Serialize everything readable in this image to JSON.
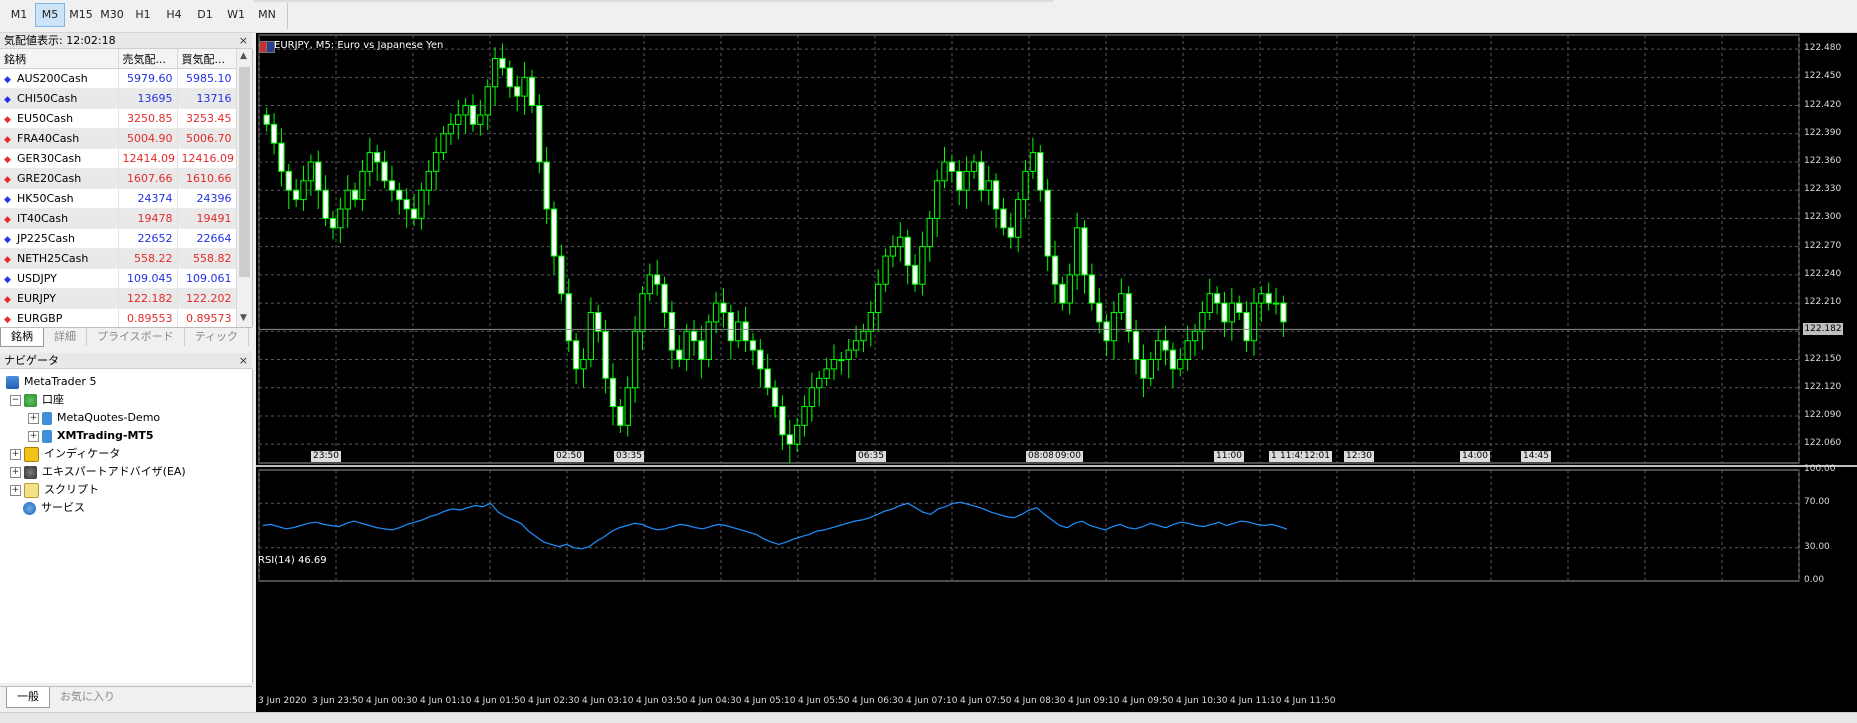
{
  "toolbar": {
    "timeframes": [
      "M1",
      "M5",
      "M15",
      "M30",
      "H1",
      "H4",
      "D1",
      "W1",
      "MN"
    ],
    "active": "M5"
  },
  "market_watch": {
    "title": "気配値表示: 12:02:18",
    "columns": [
      "銘柄",
      "売気配...",
      "買気配..."
    ],
    "rows": [
      {
        "symbol": "AUS200Cash",
        "bid": "5979.60",
        "ask": "5985.10",
        "dir": "up"
      },
      {
        "symbol": "CHI50Cash",
        "bid": "13695",
        "ask": "13716",
        "dir": "up"
      },
      {
        "symbol": "EU50Cash",
        "bid": "3250.85",
        "ask": "3253.45",
        "dir": "down"
      },
      {
        "symbol": "FRA40Cash",
        "bid": "5004.90",
        "ask": "5006.70",
        "dir": "down"
      },
      {
        "symbol": "GER30Cash",
        "bid": "12414.09",
        "ask": "12416.09",
        "dir": "down"
      },
      {
        "symbol": "GRE20Cash",
        "bid": "1607.66",
        "ask": "1610.66",
        "dir": "down"
      },
      {
        "symbol": "HK50Cash",
        "bid": "24374",
        "ask": "24396",
        "dir": "up"
      },
      {
        "symbol": "IT40Cash",
        "bid": "19478",
        "ask": "19491",
        "dir": "down"
      },
      {
        "symbol": "JP225Cash",
        "bid": "22652",
        "ask": "22664",
        "dir": "up"
      },
      {
        "symbol": "NETH25Cash",
        "bid": "558.22",
        "ask": "558.82",
        "dir": "down"
      },
      {
        "symbol": "USDJPY",
        "bid": "109.045",
        "ask": "109.061",
        "dir": "up"
      },
      {
        "symbol": "EURJPY",
        "bid": "122.182",
        "ask": "122.202",
        "dir": "down"
      },
      {
        "symbol": "EURGBP",
        "bid": "0.89553",
        "ask": "0.89573",
        "dir": "down"
      }
    ],
    "tabs": [
      "銘柄",
      "詳細",
      "プライスボード",
      "ティック"
    ],
    "close_icon": "×"
  },
  "navigator": {
    "title": "ナビゲータ",
    "root": "MetaTrader 5",
    "accounts_label": "口座",
    "accounts": [
      "MetaQuotes-Demo",
      "XMTrading-MT5"
    ],
    "indicators": "インディケータ",
    "experts": "エキスパートアドバイザ(EA)",
    "scripts": "スクリプト",
    "services": "サービス",
    "tabs": [
      "一般",
      "お気に入り"
    ]
  },
  "chart": {
    "title": "EURJPY, M5:  Euro vs Japanese Yen",
    "current_price": "122.182",
    "price_axis": [
      "122.480",
      "122.450",
      "122.420",
      "122.390",
      "122.360",
      "122.330",
      "122.300",
      "122.270",
      "122.240",
      "122.210",
      "122.150",
      "122.120",
      "122.090",
      "122.060"
    ],
    "time_axis": [
      "3 Jun 2020",
      "3 Jun 23:50",
      "4 Jun 00:30",
      "4 Jun 01:10",
      "4 Jun 01:50",
      "4 Jun 02:30",
      "4 Jun 03:10",
      "4 Jun 03:50",
      "4 Jun 04:30",
      "4 Jun 05:10",
      "4 Jun 05:50",
      "4 Jun 06:30",
      "4 Jun 07:10",
      "4 Jun 07:50",
      "4 Jun 08:30",
      "4 Jun 09:10",
      "4 Jun 09:50",
      "4 Jun 10:30",
      "4 Jun 11:10",
      "4 Jun 11:50"
    ],
    "time_tags": [
      "23:50",
      "02:50",
      "03:35",
      "06:35",
      "08:08",
      "09:00",
      "11:00",
      "1",
      "11:45",
      "12:01",
      "12:30",
      "14:00",
      "14:45"
    ],
    "rsi_title": "RSI(14) 46.69",
    "rsi_axis": [
      "100.00",
      "70.00",
      "30.00",
      "0.00"
    ],
    "colors": {
      "background": "#000000",
      "bull": "#00ff00",
      "rsi": "#1e90ff",
      "grid": "#5a5a5a"
    }
  },
  "chart_data": {
    "type": "candlestick",
    "title": "EURJPY, M5:  Euro vs Japanese Yen",
    "ylim": [
      122.04,
      122.495
    ],
    "current": 122.182,
    "closes": [
      122.4,
      122.38,
      122.35,
      122.33,
      122.32,
      122.34,
      122.36,
      122.33,
      122.3,
      122.29,
      122.31,
      122.33,
      122.32,
      122.35,
      122.37,
      122.36,
      122.34,
      122.33,
      122.32,
      122.31,
      122.3,
      122.33,
      122.35,
      122.37,
      122.39,
      122.4,
      122.41,
      122.42,
      122.4,
      122.41,
      122.44,
      122.47,
      122.46,
      122.44,
      122.43,
      122.45,
      122.42,
      122.36,
      122.31,
      122.26,
      122.22,
      122.17,
      122.14,
      122.15,
      122.2,
      122.18,
      122.13,
      122.1,
      122.08,
      122.12,
      122.18,
      122.22,
      122.24,
      122.23,
      122.2,
      122.16,
      122.15,
      122.18,
      122.17,
      122.15,
      122.19,
      122.21,
      122.2,
      122.17,
      122.19,
      122.17,
      122.16,
      122.14,
      122.12,
      122.1,
      122.07,
      122.06,
      122.08,
      122.1,
      122.12,
      122.13,
      122.14,
      122.15,
      122.15,
      122.16,
      122.17,
      122.18,
      122.2,
      122.23,
      122.26,
      122.27,
      122.28,
      122.25,
      122.23,
      122.27,
      122.3,
      122.34,
      122.36,
      122.35,
      122.33,
      122.35,
      122.36,
      122.33,
      122.34,
      122.31,
      122.29,
      122.28,
      122.32,
      122.35,
      122.37,
      122.33,
      122.26,
      122.23,
      122.21,
      122.24,
      122.29,
      122.24,
      122.21,
      122.19,
      122.17,
      122.2,
      122.22,
      122.18,
      122.15,
      122.13,
      122.15,
      122.17,
      122.16,
      122.14,
      122.15,
      122.17,
      122.18,
      122.2,
      122.22,
      122.21,
      122.19,
      122.21,
      122.2,
      122.17,
      122.21,
      122.22,
      122.21,
      122.21,
      122.19
    ],
    "rsi": [
      50,
      51,
      49,
      47,
      48,
      50,
      52,
      53,
      51,
      50,
      49,
      52,
      54,
      52,
      50,
      48,
      47,
      46,
      48,
      51,
      53,
      55,
      58,
      60,
      63,
      65,
      64,
      66,
      68,
      67,
      70,
      62,
      58,
      55,
      52,
      45,
      40,
      35,
      33,
      31,
      33,
      30,
      29,
      31,
      36,
      40,
      45,
      48,
      50,
      52,
      51,
      48,
      46,
      47,
      49,
      51,
      50,
      48,
      47,
      49,
      51,
      50,
      48,
      46,
      44,
      42,
      38,
      35,
      33,
      35,
      38,
      40,
      42,
      45,
      46,
      48,
      50,
      52,
      54,
      55,
      57,
      60,
      63,
      65,
      68,
      70,
      66,
      62,
      60,
      65,
      67,
      70,
      71,
      69,
      67,
      65,
      62,
      60,
      58,
      57,
      60,
      64,
      66,
      60,
      55,
      50,
      48,
      52,
      54,
      50,
      48,
      46,
      49,
      51,
      48,
      47,
      49,
      52,
      50,
      48,
      51,
      53,
      52,
      50,
      49,
      51,
      53,
      50,
      52,
      54,
      53,
      51,
      50,
      51,
      49,
      46.69
    ]
  }
}
